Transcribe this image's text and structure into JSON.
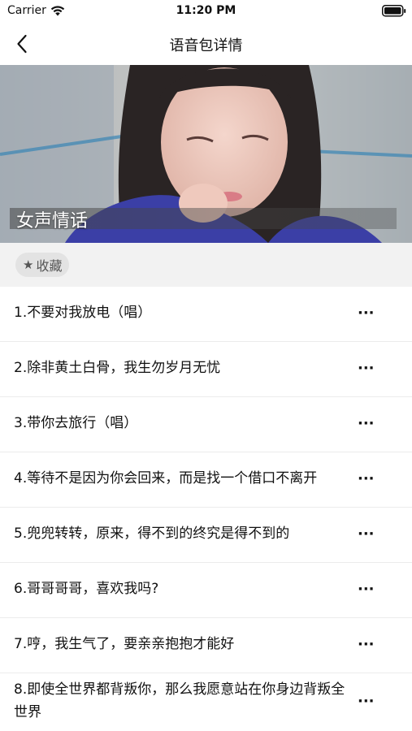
{
  "status_bar": {
    "carrier": "Carrier",
    "time": "11:20 PM",
    "wifi_icon": "wifi-icon",
    "battery_icon": "battery-icon"
  },
  "nav": {
    "title": "语音包详情",
    "back_icon": "chevron-left-icon"
  },
  "banner": {
    "title": "女声情话"
  },
  "favorite": {
    "icon": "star-icon",
    "label": "收藏"
  },
  "list": {
    "more_icon": "more-horizontal-icon",
    "items": [
      {
        "label": "1.不要对我放电（唱）"
      },
      {
        "label": "2.除非黄土白骨，我生勿岁月无忧"
      },
      {
        "label": "3.带你去旅行（唱）"
      },
      {
        "label": "4.等待不是因为你会回来，而是找一个借口不离开"
      },
      {
        "label": "5.兜兜转转，原来，得不到的终究是得不到的"
      },
      {
        "label": "6.哥哥哥哥，喜欢我吗?"
      },
      {
        "label": "7.哼，我生气了，要亲亲抱抱才能好"
      },
      {
        "label": "8.即使全世界都背叛你，那么我愿意站在你身边背叛全世界"
      }
    ]
  }
}
